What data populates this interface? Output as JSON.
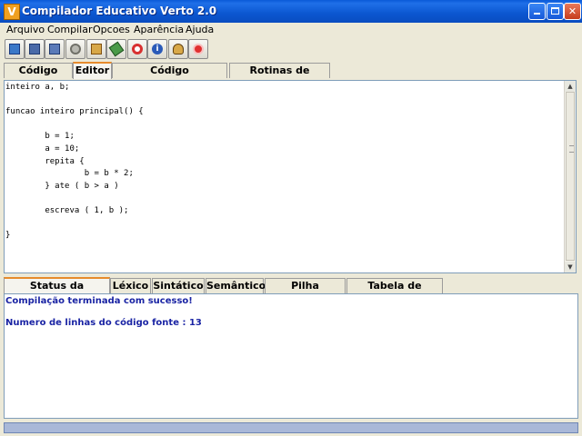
{
  "window": {
    "title": "Compilador Educativo Verto 2.0",
    "app_icon_letter": "V",
    "controls": [
      "minimize-icon",
      "maximize-icon",
      "close-icon"
    ]
  },
  "menu": [
    "Arquivo",
    "Compilar",
    "Opcoes",
    "Aparência",
    "Ajuda"
  ],
  "toolbar": {
    "buttons": [
      "new-file-icon",
      "save-icon",
      "save-as-icon",
      "settings-icon",
      "build-icon",
      "eraser-icon",
      "help-lifebuoy-icon",
      "info-icon",
      "about-icon",
      "stop-icon"
    ]
  },
  "editor_tabs": {
    "items": [
      "Código Fonte",
      "Editor",
      "Código MacroAssembler",
      "Rotinas de Biblioteca"
    ],
    "active": "Editor"
  },
  "code": "inteiro a, b;\n\nfuncao inteiro principal() {\n\n        b = 1;\n        a = 10;\n        repita {\n                b = b * 2;\n        } ate ( b > a )\n\n        escreva ( 1, b );\n\n}",
  "output_tabs": {
    "items": [
      "Status da Compilação",
      "Léxico",
      "Sintático",
      "Semântico",
      "Pilha Semântica",
      "Tabela de Símbolos"
    ],
    "active": "Status da Compilação"
  },
  "output": {
    "message": "Compilação terminada com sucesso!",
    "line_count": "Numero de linhas do código fonte : 13"
  },
  "colors": {
    "titlebar": "#0a57d0",
    "tab_highlight": "#e68b2c",
    "output_text": "#1a24a4",
    "statusbar": "#a9b8d8"
  }
}
